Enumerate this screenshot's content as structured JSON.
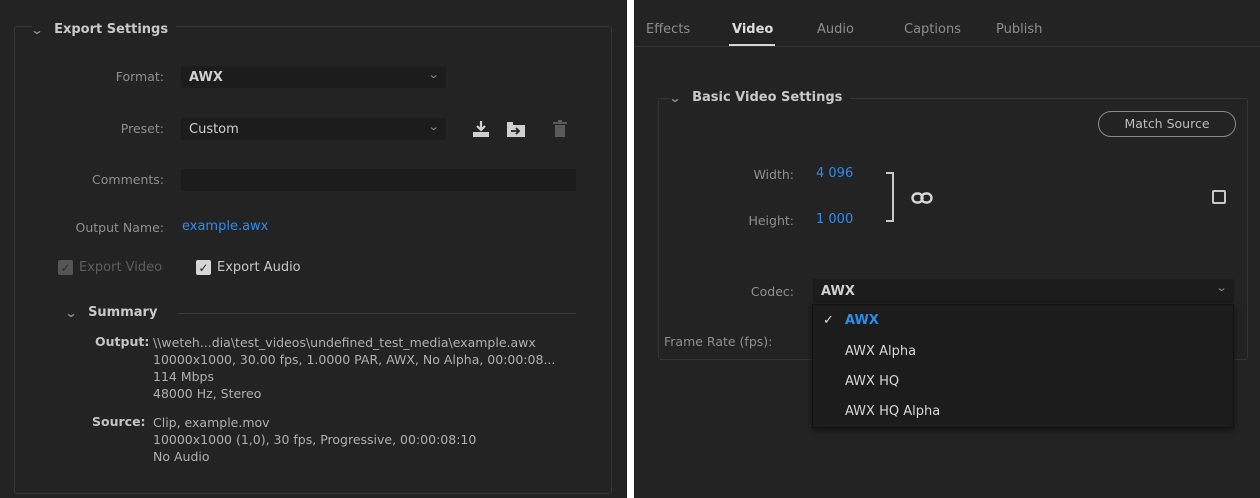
{
  "export_settings": {
    "title": "Export Settings",
    "format_label": "Format:",
    "format_value": "AWX",
    "preset_label": "Preset:",
    "preset_value": "Custom",
    "comments_label": "Comments:",
    "comments_value": "",
    "output_name_label": "Output Name:",
    "output_name_value": "example.awx",
    "export_video_label": "Export Video",
    "export_video_checked": true,
    "export_audio_label": "Export Audio",
    "export_audio_checked": true,
    "summary": {
      "title": "Summary",
      "output_label": "Output:",
      "output_lines": [
        "\\\\weteh...dia\\test_videos\\undefined_test_media\\example.awx",
        "10000x1000, 30.00 fps, 1.0000 PAR, AWX, No Alpha, 00:00:08...",
        "114 Mbps",
        "48000 Hz, Stereo"
      ],
      "source_label": "Source:",
      "source_lines": [
        "Clip, example.mov",
        "10000x1000 (1,0), 30 fps, Progressive, 00:00:08:10",
        "No Audio"
      ]
    },
    "icons": [
      "chevron-down-icon",
      "save-preset-icon",
      "import-preset-icon",
      "trash-icon",
      "checkmark-icon"
    ]
  },
  "video_panel": {
    "tabs": [
      {
        "label": "Effects",
        "active": false
      },
      {
        "label": "Video",
        "active": true
      },
      {
        "label": "Audio",
        "active": false
      },
      {
        "label": "Captions",
        "active": false
      },
      {
        "label": "Publish",
        "active": false
      }
    ],
    "section_title": "Basic Video Settings",
    "match_source_label": "Match Source",
    "width_label": "Width:",
    "width_value": "4 096",
    "height_label": "Height:",
    "height_value": "1 000",
    "codec_label": "Codec:",
    "codec_value": "AWX",
    "frame_rate_label": "Frame Rate (fps):",
    "codec_options": [
      {
        "label": "AWX",
        "selected": true
      },
      {
        "label": "AWX Alpha",
        "selected": false
      },
      {
        "label": "AWX HQ",
        "selected": false
      },
      {
        "label": "AWX HQ Alpha",
        "selected": false
      }
    ],
    "icons": [
      "link-icon",
      "checkbox-icon",
      "chevron-down-icon",
      "checkmark-icon"
    ]
  },
  "colors": {
    "panel_bg": "#232323",
    "field_bg": "#1c1c1c",
    "accent_blue": "#2d8ceb",
    "text": "#a8a8a8"
  }
}
